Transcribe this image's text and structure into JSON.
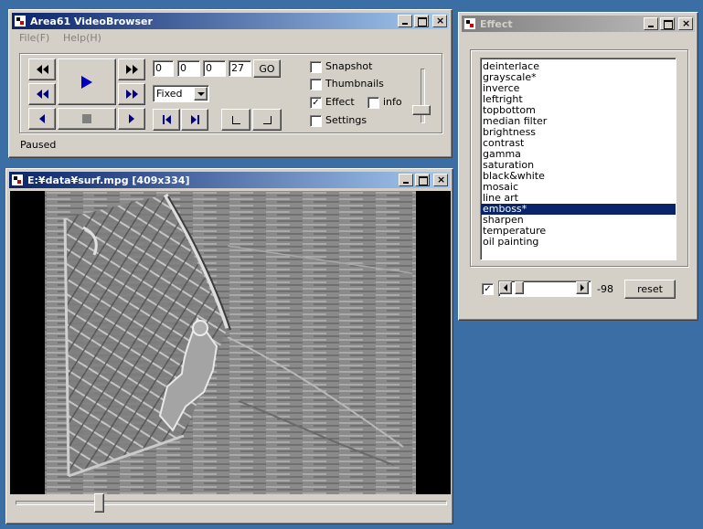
{
  "main_window": {
    "title": "Area61 VideoBrowser",
    "menu": [
      "File(F)",
      "Help(H)"
    ],
    "frame_fields": [
      "0",
      "0",
      "0",
      "27"
    ],
    "go_label": "GO",
    "mode_select": "Fixed",
    "checkboxes": {
      "snapshot": {
        "label": "Snapshot",
        "checked": false
      },
      "thumbnails": {
        "label": "Thumbnails",
        "checked": false
      },
      "effect": {
        "label": "Effect",
        "checked": true
      },
      "info": {
        "label": "info",
        "checked": false
      },
      "settings": {
        "label": "Settings",
        "checked": false
      }
    },
    "status": "Paused"
  },
  "video_window": {
    "title": "E:¥data¥surf.mpg [409x334]"
  },
  "effect_window": {
    "title": "Effect",
    "items": [
      "deinterlace",
      "grayscale*",
      "inverce",
      "leftright",
      "topbottom",
      "median filter",
      "brightness",
      "contrast",
      "gamma",
      "saturation",
      "black&white",
      "mosaic",
      "line art",
      "emboss*",
      "sharpen",
      "temperature",
      "oil painting"
    ],
    "selected": "emboss*",
    "enabled_checked": true,
    "value": "-98",
    "reset_label": "reset"
  },
  "colors": {
    "desktop": "#3a6ea5",
    "active_title": "#0a246a",
    "face": "#d4d0c8",
    "play_glyph": "#000080"
  }
}
